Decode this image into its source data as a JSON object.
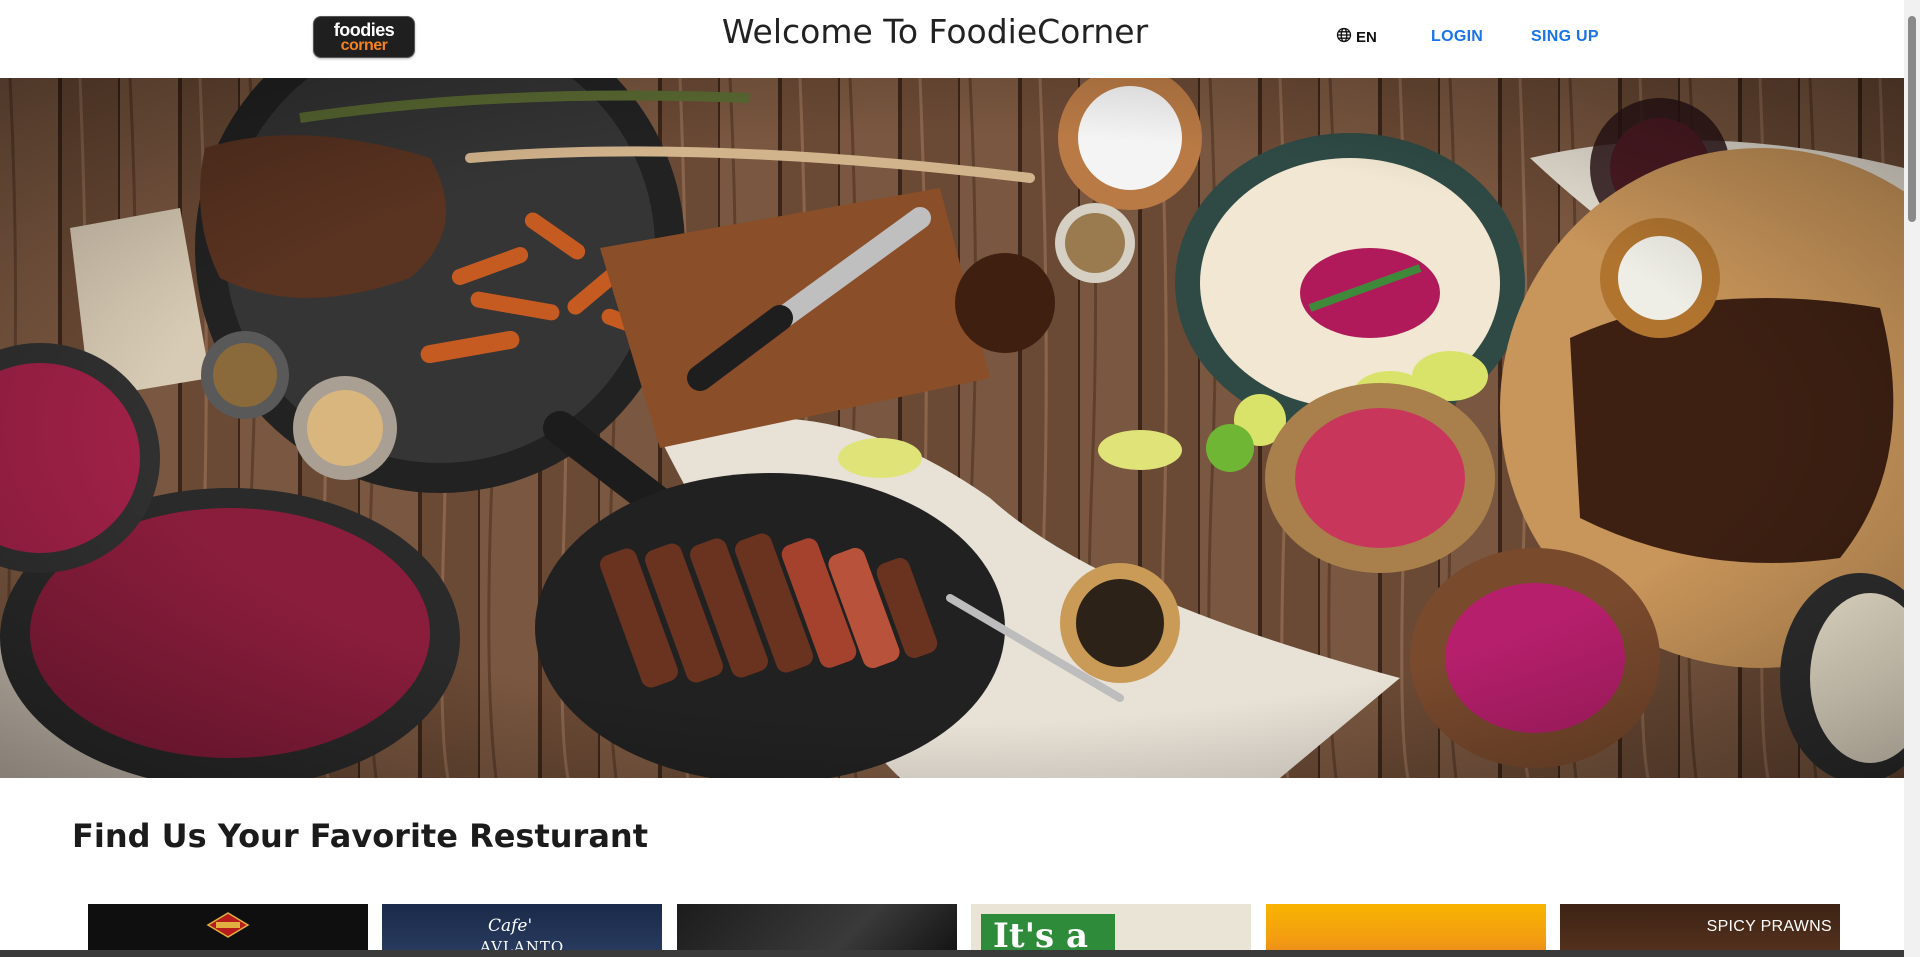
{
  "header": {
    "logo": {
      "line1": "foodies",
      "line2": "corner"
    },
    "title": "Welcome To FoodieCorner",
    "language": {
      "icon": "globe-icon",
      "label": "EN"
    },
    "login_label": "LOGIN",
    "signup_label": "SING UP"
  },
  "hero": {
    "icon": "hero-food-image"
  },
  "section": {
    "title": "Find Us Your Favorite Resturant"
  },
  "cards": [
    {
      "name": "restaurant-card-1",
      "text": ""
    },
    {
      "name": "restaurant-card-2",
      "text": "Cafe'",
      "text2": "AVLANTO"
    },
    {
      "name": "restaurant-card-3",
      "text": ""
    },
    {
      "name": "restaurant-card-4",
      "text": "It's a"
    },
    {
      "name": "restaurant-card-5",
      "text": ""
    },
    {
      "name": "restaurant-card-6",
      "text": "SPICY PRAWNS"
    }
  ],
  "colors": {
    "link": "#1a73e8",
    "logo_orange": "#f58220",
    "text_dark": "#222222"
  }
}
